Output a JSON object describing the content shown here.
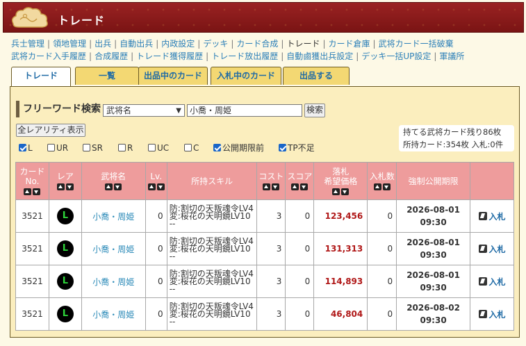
{
  "header": {
    "title": "トレード"
  },
  "nav": {
    "row1": [
      "兵士管理",
      "領地管理",
      "出兵",
      "自動出兵",
      "内政設定",
      "デッキ",
      "カード合成",
      "トレード",
      "カード倉庫",
      "武将カード一括破棄"
    ],
    "row2": [
      "武将カード入手履歴",
      "合成履歴",
      "トレード獲得履歴",
      "トレード放出履歴",
      "自動鹵獲出兵設定",
      "デッキ一括UP設定",
      "軍議所"
    ],
    "current": "トレード"
  },
  "tabs": [
    "トレード",
    "一覧",
    "出品中のカード",
    "入札中のカード",
    "出品する"
  ],
  "search": {
    "title": "フリーワード検索",
    "select_value": "武将名",
    "input_value": "小喬・周姫",
    "button": "検索"
  },
  "rarity_button": "全レアリティ表示",
  "filters": [
    {
      "label": "L",
      "checked": true
    },
    {
      "label": "UR",
      "checked": false
    },
    {
      "label": "SR",
      "checked": false
    },
    {
      "label": "R",
      "checked": false
    },
    {
      "label": "UC",
      "checked": false
    },
    {
      "label": "C",
      "checked": false
    },
    {
      "label": "公開期限前",
      "checked": true
    },
    {
      "label": "TP不足",
      "checked": true
    }
  ],
  "info": {
    "line1": "持てる武将カード残り86枚",
    "line2": "所持カード:354枚 入札:0件"
  },
  "table": {
    "headers": {
      "card_no_1": "カード",
      "card_no_2": "No.",
      "rarity": "レア",
      "name": "武将名",
      "lv": "Lv.",
      "skill": "所持スキル",
      "cost": "コスト",
      "score": "スコア",
      "price_1": "落札",
      "price_2": "希望価格",
      "bids": "入札数",
      "deadline": "強制公開期限"
    },
    "rows": [
      {
        "no": "3521",
        "rarity": "L",
        "name": "小喬・周姫",
        "lv": "0",
        "skill1": "防:割切の天叛魂令LV4",
        "skill2": "変:桜花の天明鏡LV10",
        "skill3": "--",
        "cost": "3",
        "score": "0",
        "price": "123,456",
        "bids": "0",
        "date": "2026-08-01",
        "time": "09:30",
        "bid": "入札"
      },
      {
        "no": "3521",
        "rarity": "L",
        "name": "小喬・周姫",
        "lv": "0",
        "skill1": "防:割切の天叛魂令LV4",
        "skill2": "変:桜花の天明鏡LV10",
        "skill3": "--",
        "cost": "3",
        "score": "0",
        "price": "131,313",
        "bids": "0",
        "date": "2026-08-01",
        "time": "09:30",
        "bid": "入札"
      },
      {
        "no": "3521",
        "rarity": "L",
        "name": "小喬・周姫",
        "lv": "0",
        "skill1": "防:割切の天叛魂令LV4",
        "skill2": "変:桜花の天明鏡LV10",
        "skill3": "--",
        "cost": "3",
        "score": "0",
        "price": "114,893",
        "bids": "0",
        "date": "2026-08-01",
        "time": "09:30",
        "bid": "入札"
      },
      {
        "no": "3521",
        "rarity": "L",
        "name": "小喬・周姫",
        "lv": "0",
        "skill1": "防:割切の天叛魂令LV4",
        "skill2": "変:桜花の天明鏡LV10",
        "skill3": "--",
        "cost": "3",
        "score": "0",
        "price": "46,804",
        "bids": "0",
        "date": "2026-08-02",
        "time": "09:30",
        "bid": "入札"
      }
    ]
  },
  "icons": {
    "logo": "cloud-logo-icon",
    "sort_up": "sort-up-icon",
    "sort_down": "sort-down-icon",
    "bid": "bid-arrow-icon",
    "select_caret": "chevron-down-icon"
  },
  "colors": {
    "header_bg": "#8c1c1c",
    "tab_bg": "#f3d873",
    "panel_bg": "#fbeebe",
    "table_header_bg": "#ee9c9c",
    "link": "#2b7fb8",
    "price": "#b01818",
    "rarity_L": "#2ed43a"
  }
}
